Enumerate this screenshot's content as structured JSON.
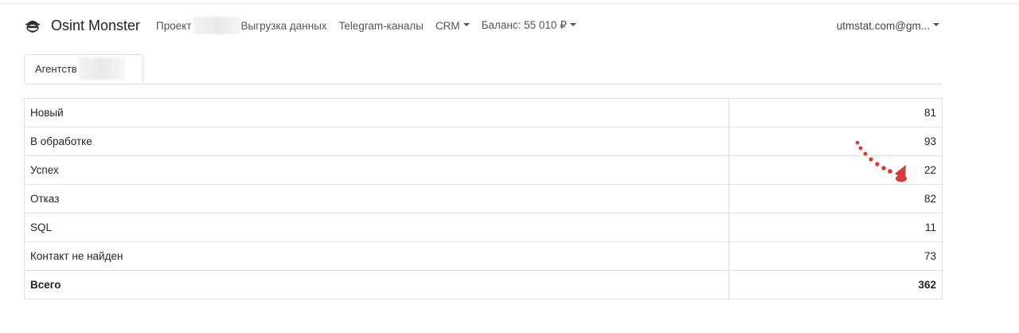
{
  "brand": {
    "name": "Osint Monster",
    "logo_icon": "spy-mask-icon"
  },
  "nav": {
    "projects_label": "Проект",
    "export_label": "Выгрузка данных",
    "telegram_label": "Telegram-каналы",
    "crm_label": "CRM",
    "balance_label": "Баланс: 55 010 ₽"
  },
  "user": {
    "email": "utmstat.com@gm..."
  },
  "tabs": [
    {
      "label": "Агентств"
    }
  ],
  "table": {
    "rows": [
      {
        "label": "Новый",
        "value": "81"
      },
      {
        "label": "В обработке",
        "value": "93"
      },
      {
        "label": "Успех",
        "value": "22"
      },
      {
        "label": "Отказ",
        "value": "82"
      },
      {
        "label": "SQL",
        "value": "11"
      },
      {
        "label": "Контакт не найден",
        "value": "73"
      }
    ],
    "total": {
      "label": "Всего",
      "value": "362"
    }
  },
  "annotation": {
    "color": "#d93a35"
  },
  "colors": {
    "border": "#dee2e6",
    "text": "#212529"
  }
}
